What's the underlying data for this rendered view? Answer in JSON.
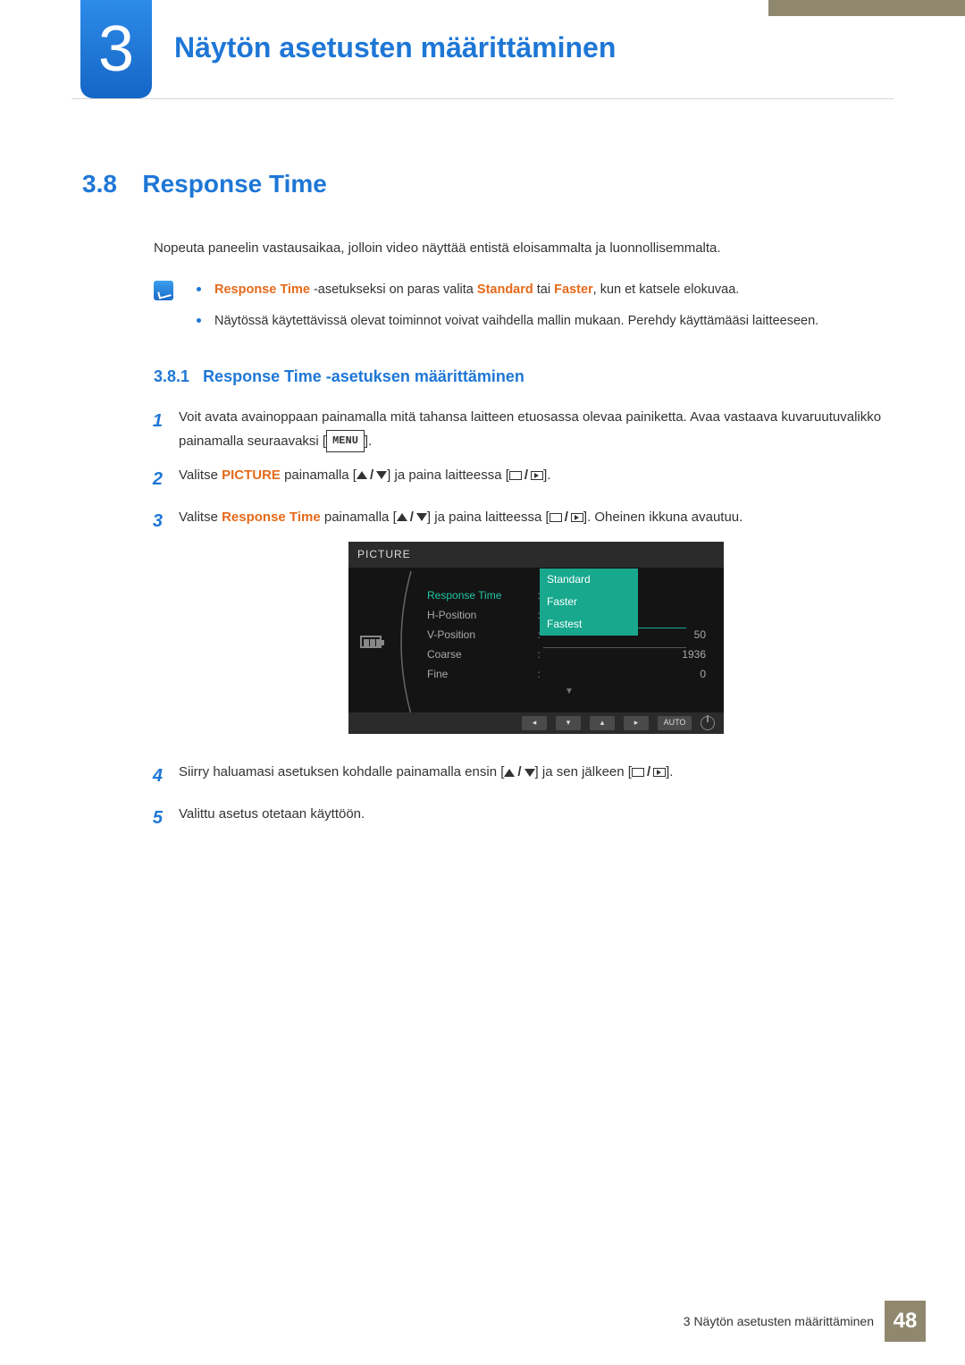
{
  "chapter": {
    "number": "3",
    "title": "Näytön asetusten määrittäminen"
  },
  "section": {
    "number": "3.8",
    "title": "Response Time"
  },
  "lead": "Nopeuta paneelin vastausaikaa, jolloin video näyttää entistä eloisammalta ja luonnollisemmalta.",
  "notes": {
    "item1": {
      "pre": "Response Time",
      "mid1": " -asetukseksi on paras valita ",
      "opt1": "Standard",
      "mid2": " tai ",
      "opt2": "Faster",
      "post": ", kun et katsele elokuvaa."
    },
    "item2": "Näytössä käytettävissä olevat toiminnot voivat vaihdella mallin mukaan. Perehdy käyttämääsi laitteeseen."
  },
  "subsection": {
    "number": "3.8.1",
    "title": "Response Time -asetuksen määrittäminen"
  },
  "steps": {
    "s1": "Voit avata avainoppaan painamalla mitä tahansa laitteen etuosassa olevaa painiketta. Avaa vastaava kuvaruutuvalikko painamalla seuraavaksi [",
    "s1b": "].",
    "menu_label": "MENU",
    "s2a": "Valitse ",
    "s2_picture": "PICTURE",
    "s2b": " painamalla [",
    "s2c": "] ja paina laitteessa [",
    "s2d": "].",
    "s3a": "Valitse ",
    "s3_rt": "Response Time",
    "s3b": " painamalla [",
    "s3c": "] ja paina laitteessa [",
    "s3d": "]. Oheinen ikkuna avautuu.",
    "s4a": "Siirry haluamasi asetuksen kohdalle painamalla ensin [",
    "s4b": "] ja sen jälkeen [",
    "s4c": "].",
    "s5": "Valittu asetus otetaan käyttöön."
  },
  "osd": {
    "header": "PICTURE",
    "rows": [
      {
        "label": "Response Time",
        "value": ""
      },
      {
        "label": "H-Position",
        "value": ""
      },
      {
        "label": "V-Position",
        "value": "50"
      },
      {
        "label": "Coarse",
        "value": "1936"
      },
      {
        "label": "Fine",
        "value": "0"
      }
    ],
    "dropdown": [
      "Standard",
      "Faster",
      "Fastest"
    ],
    "auto": "AUTO"
  },
  "footer": {
    "text": "3 Näytön asetusten määrittäminen",
    "page": "48"
  }
}
